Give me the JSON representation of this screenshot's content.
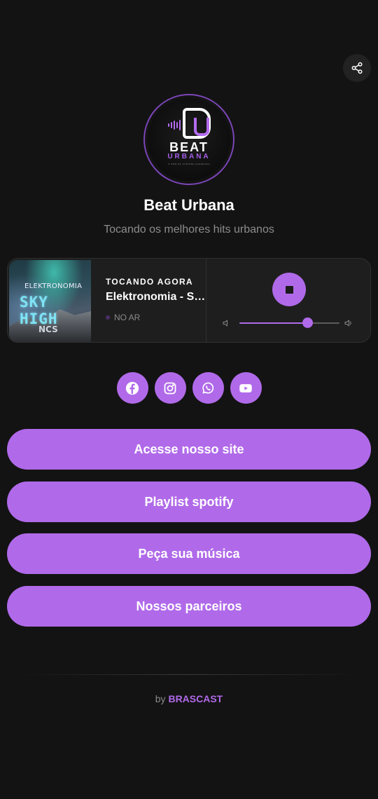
{
  "station": {
    "name": "Beat Urbana",
    "description": "Tocando os melhores hits urbanos"
  },
  "logo": {
    "title": "BEAT",
    "subtitle": "URBANA",
    "tagline": "A SOM DA CULTURA AVANÇADA"
  },
  "player": {
    "now_playing_label": "TOCANDO AGORA",
    "track_title": "Elektronomia - Sky High",
    "status_text": "NO AR",
    "volume": 0.68,
    "state": "playing",
    "cover": {
      "artist_text": "ELEKTRONOMIA",
      "title_text": "SKY HIGH",
      "label_text": "NCS"
    }
  },
  "socials": [
    {
      "name": "facebook-icon"
    },
    {
      "name": "instagram-icon"
    },
    {
      "name": "whatsapp-icon"
    },
    {
      "name": "youtube-icon"
    }
  ],
  "links": [
    {
      "label": "Acesse nosso site"
    },
    {
      "label": "Playlist spotify"
    },
    {
      "label": "Peça sua música"
    },
    {
      "label": "Nossos parceiros"
    }
  ],
  "footer": {
    "prefix": "by",
    "brand": "BRASCAST"
  },
  "colors": {
    "background": "#131313",
    "accent": "#b06ae9",
    "card": "#1e1e1e"
  }
}
